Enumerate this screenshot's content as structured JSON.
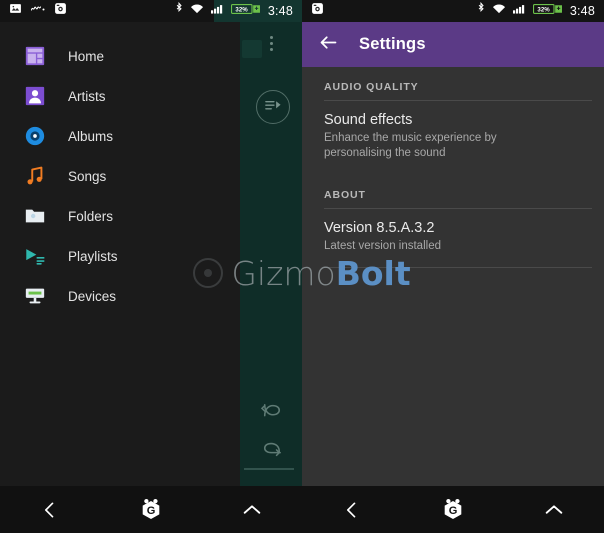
{
  "left_phone": {
    "status_bar": {
      "left_icons": [
        "image-icon",
        "walkman-icon",
        "camera-icon"
      ],
      "bluetooth_icon": "bluetooth-icon",
      "wifi_icon": "wifi-icon",
      "signal_icon": "signal-icon",
      "battery_level": "32%",
      "time": "3:48"
    },
    "drawer": {
      "items": [
        {
          "label": "Home",
          "icon": "home-icon",
          "color": "#8a5fd6"
        },
        {
          "label": "Artists",
          "icon": "artist-icon",
          "color": "#7c4dd1"
        },
        {
          "label": "Albums",
          "icon": "album-icon",
          "color": "#1e8ce0"
        },
        {
          "label": "Songs",
          "icon": "songs-icon",
          "color": "#f07c22"
        },
        {
          "label": "Folders",
          "icon": "folder-icon",
          "color": "#e8eef2"
        },
        {
          "label": "Playlists",
          "icon": "playlist-icon",
          "color": "#2fb8ae"
        },
        {
          "label": "Devices",
          "icon": "devices-icon",
          "color": "#6cc24a"
        }
      ]
    },
    "player_panel": {
      "overflow_icon": "overflow-menu-icon",
      "queue_icon": "play-queue-icon",
      "shuffle_icon": "shuffle-icon",
      "repeat_icon": "repeat-icon",
      "background_color": "#12342e"
    },
    "nav_bar": {
      "back_icon": "back-chevron-icon",
      "home_icon": "gizmobolt-home-icon",
      "recents_icon": "up-chevron-icon"
    }
  },
  "right_phone": {
    "status_bar": {
      "left_icons": [
        "camera-icon"
      ],
      "bluetooth_icon": "bluetooth-icon",
      "wifi_icon": "wifi-icon",
      "signal_icon": "signal-icon",
      "battery_level": "32%",
      "time": "3:48"
    },
    "app_bar": {
      "back_icon": "back-arrow-icon",
      "title": "Settings",
      "color": "#5b3a86"
    },
    "sections": [
      {
        "header": "AUDIO QUALITY",
        "rows": [
          {
            "title": "Sound effects",
            "subtitle": "Enhance the music experience by personalising the sound"
          }
        ]
      },
      {
        "header": "ABOUT",
        "rows": [
          {
            "title": "Version 8.5.A.3.2",
            "subtitle": "Latest version installed"
          }
        ]
      }
    ],
    "nav_bar": {
      "back_icon": "back-chevron-icon",
      "home_icon": "gizmobolt-home-icon",
      "recents_icon": "up-chevron-icon"
    }
  },
  "watermark": {
    "text_primary": "Gizmo",
    "text_accent": "Bolt",
    "accent_color": "#5b8fc4"
  }
}
